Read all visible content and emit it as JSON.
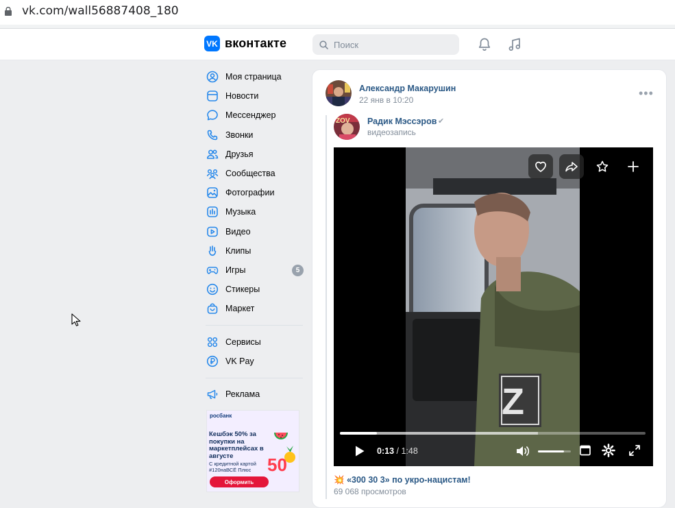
{
  "browser": {
    "url": "vk.com/wall56887408_180"
  },
  "header": {
    "logo_mark": "VK",
    "logo_text": "вконтакте",
    "search_placeholder": "Поиск",
    "icons": [
      "bell-icon",
      "music-note-icon"
    ]
  },
  "sidebar": {
    "items": [
      {
        "label": "Моя страница",
        "icon": "user-circle-icon"
      },
      {
        "label": "Новости",
        "icon": "news-icon"
      },
      {
        "label": "Мессенджер",
        "icon": "message-icon"
      },
      {
        "label": "Звонки",
        "icon": "phone-icon"
      },
      {
        "label": "Друзья",
        "icon": "friends-icon"
      },
      {
        "label": "Сообщества",
        "icon": "communities-icon"
      },
      {
        "label": "Фотографии",
        "icon": "photo-icon"
      },
      {
        "label": "Музыка",
        "icon": "music-icon"
      },
      {
        "label": "Видео",
        "icon": "video-icon"
      },
      {
        "label": "Клипы",
        "icon": "clips-icon"
      },
      {
        "label": "Игры",
        "icon": "gamepad-icon",
        "badge": "5"
      },
      {
        "label": "Стикеры",
        "icon": "smile-icon"
      },
      {
        "label": "Маркет",
        "icon": "bag-icon"
      }
    ],
    "secondary": [
      {
        "label": "Сервисы",
        "icon": "services-icon"
      },
      {
        "label": "VK Pay",
        "icon": "vkpay-icon"
      }
    ],
    "tertiary": [
      {
        "label": "Реклама",
        "icon": "megaphone-icon"
      }
    ],
    "ad": {
      "brand": "росбанк",
      "headline": "Кешбэк 50% за покупки на маркетплейсах в августе",
      "subtext": "С кредитной картой #120наВСЁ Плюс",
      "big_number": "50",
      "cta": "Оформить"
    }
  },
  "post": {
    "author": "Александр Макарушин",
    "date": "22 янв в 10:20",
    "more": "•••",
    "repost": {
      "author": "Радик Мэссэров",
      "verified_mark": "✔",
      "subtitle": "видеозапись",
      "avatar_text": "ZOV"
    },
    "video": {
      "current_time": "0:13",
      "total_time": "1:48",
      "progress": 0.12,
      "volume": 0.8,
      "title": "«300 30 3» по укро-нацистам!",
      "title_emoji": "💥",
      "views": "69 068 просмотров",
      "patch_letter": "Z",
      "actions": [
        "heart-icon",
        "share-icon",
        "star-icon",
        "plus-icon"
      ]
    }
  },
  "colors": {
    "accent": "#0077ff",
    "link": "#2a5885",
    "muted": "#818c99",
    "bg": "#edeef0"
  }
}
